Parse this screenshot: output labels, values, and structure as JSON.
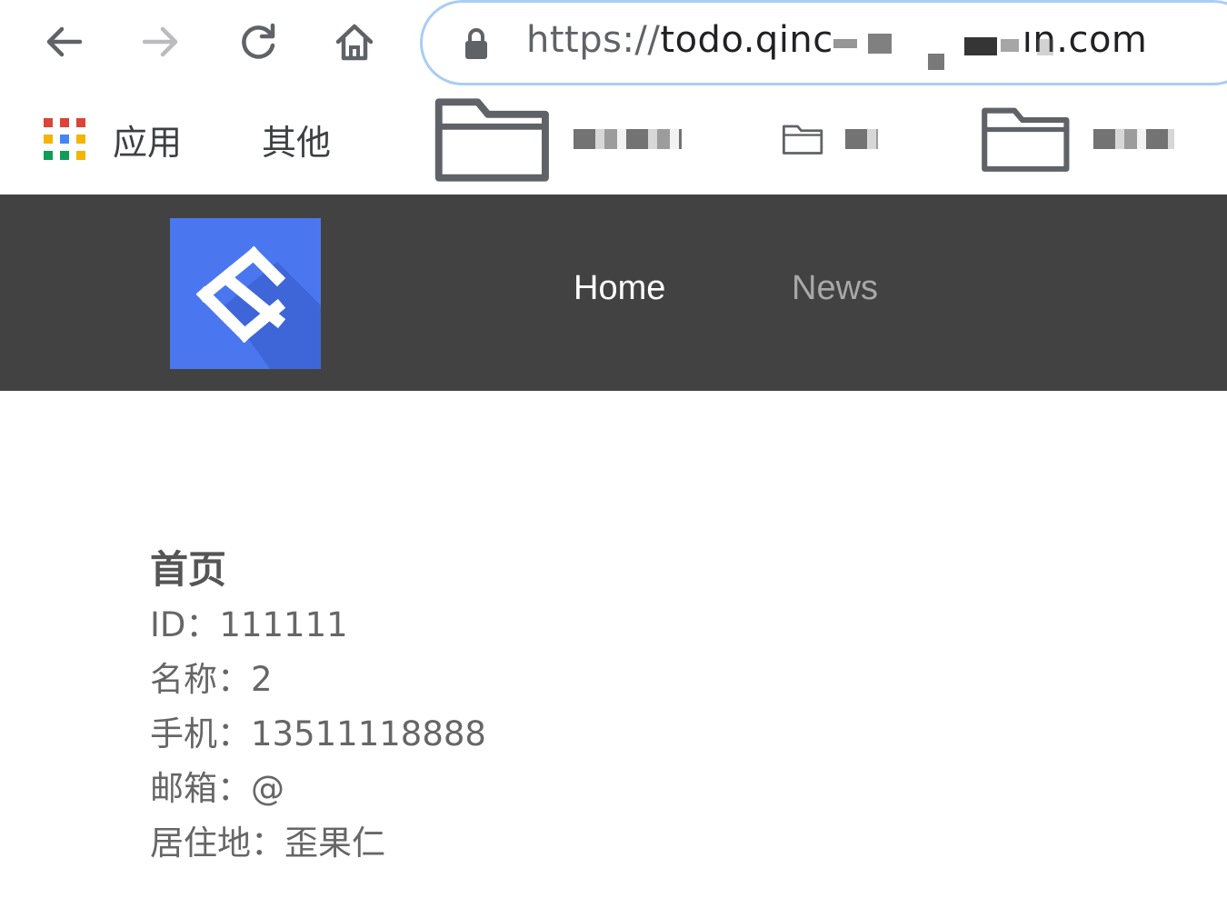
{
  "browser": {
    "url_scheme": "https://",
    "url_host_visible_start": "todo.qinc",
    "url_host_visible_end": "ın.com",
    "bookmarks": [
      {
        "label": "应用",
        "icon": "apps-grid-icon"
      },
      {
        "label": "其他",
        "icon": "folder-icon"
      },
      {
        "label": "",
        "icon": "folder-icon"
      },
      {
        "label": "",
        "icon": "folder-icon"
      },
      {
        "label": "",
        "icon": "folder-icon"
      }
    ],
    "nav_icons": [
      "back-arrow-icon",
      "forward-arrow-icon",
      "reload-icon",
      "home-icon",
      "lock-icon"
    ]
  },
  "header": {
    "background_color": "#424242",
    "logo_color": "#4a77f0",
    "menu": [
      {
        "label": "Home",
        "active": true
      },
      {
        "label": "News",
        "active": false
      }
    ]
  },
  "main": {
    "title": "首页",
    "fields": [
      {
        "label": "ID：",
        "value": "111111"
      },
      {
        "label": "名称：",
        "value": "2"
      },
      {
        "label": "手机：",
        "value": "13511118888"
      },
      {
        "label": "邮箱：",
        "value": "@"
      },
      {
        "label": "居住地：",
        "value": "歪果仁"
      }
    ]
  }
}
